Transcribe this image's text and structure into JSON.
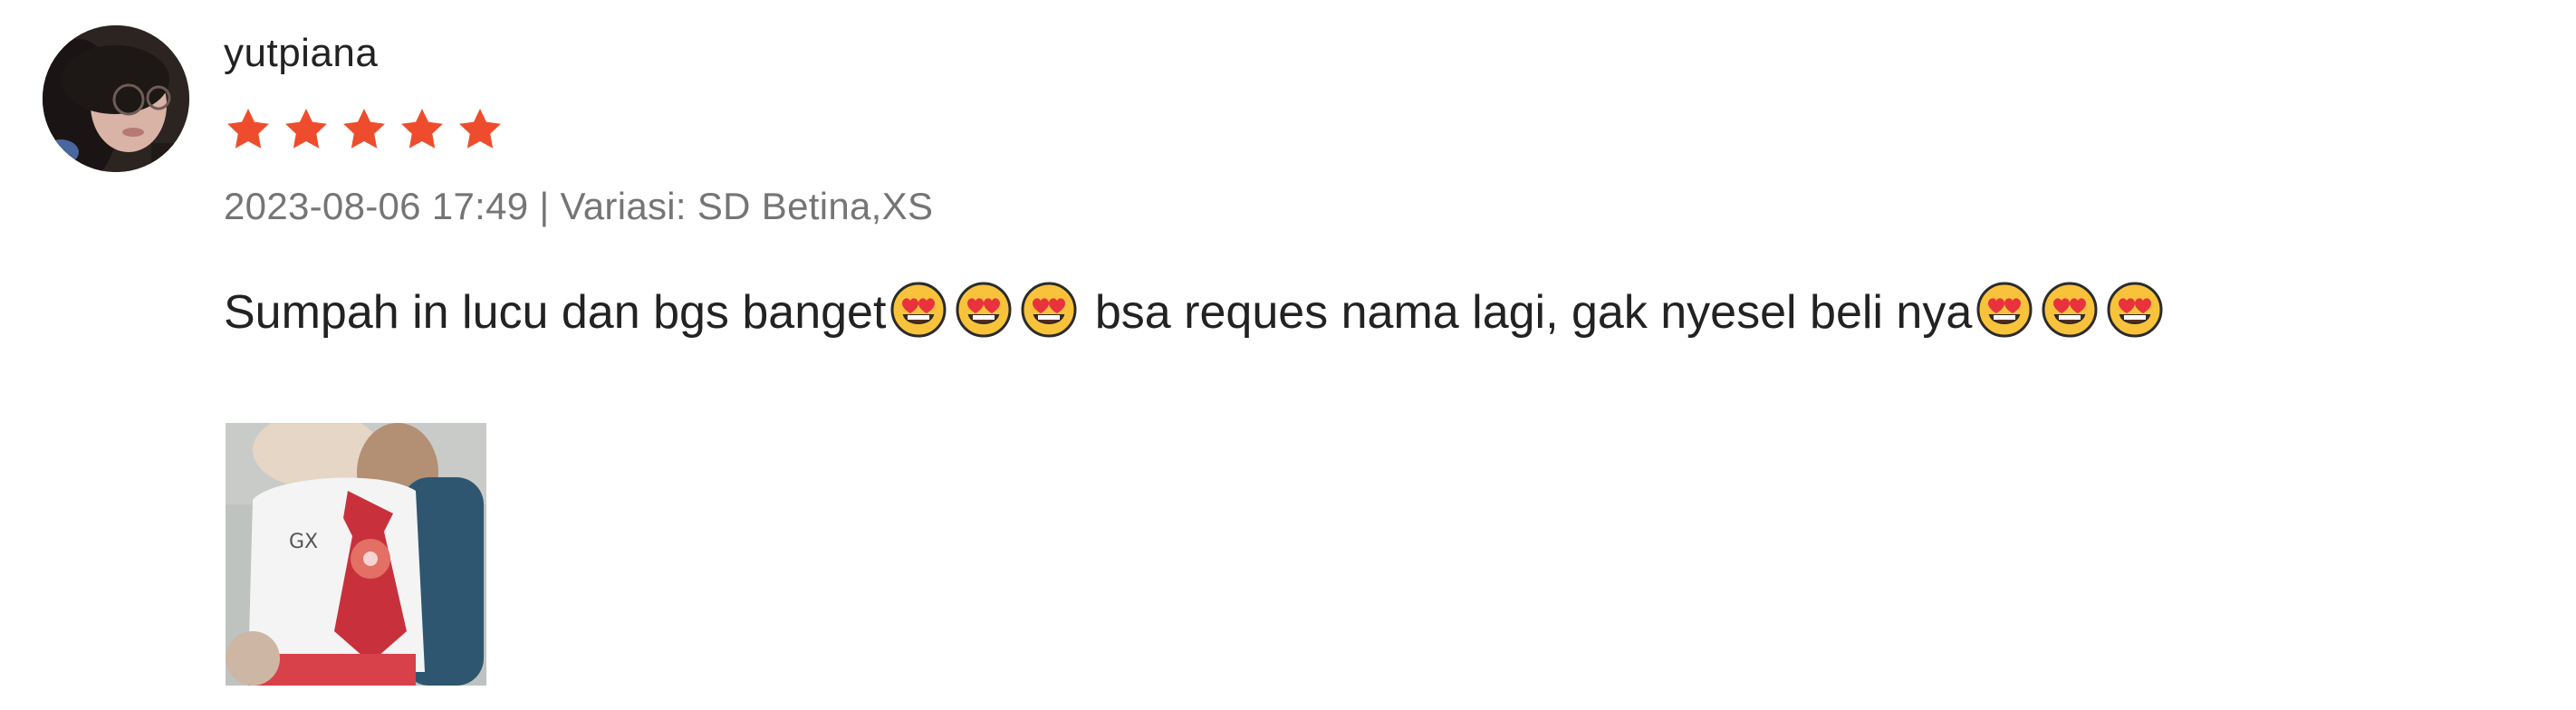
{
  "review": {
    "username": "yutpiana",
    "rating": 5,
    "meta": "2023-08-06 17:49 | Variasi: SD Betina,XS",
    "comment_part1": "Sumpah in lucu dan bgs banget",
    "comment_part2": " bsa reques nama lagi, gak nyesel beli nya",
    "emoji_name": "smiling-face-with-heart-eyes",
    "star_color": "#ee4d2d"
  }
}
